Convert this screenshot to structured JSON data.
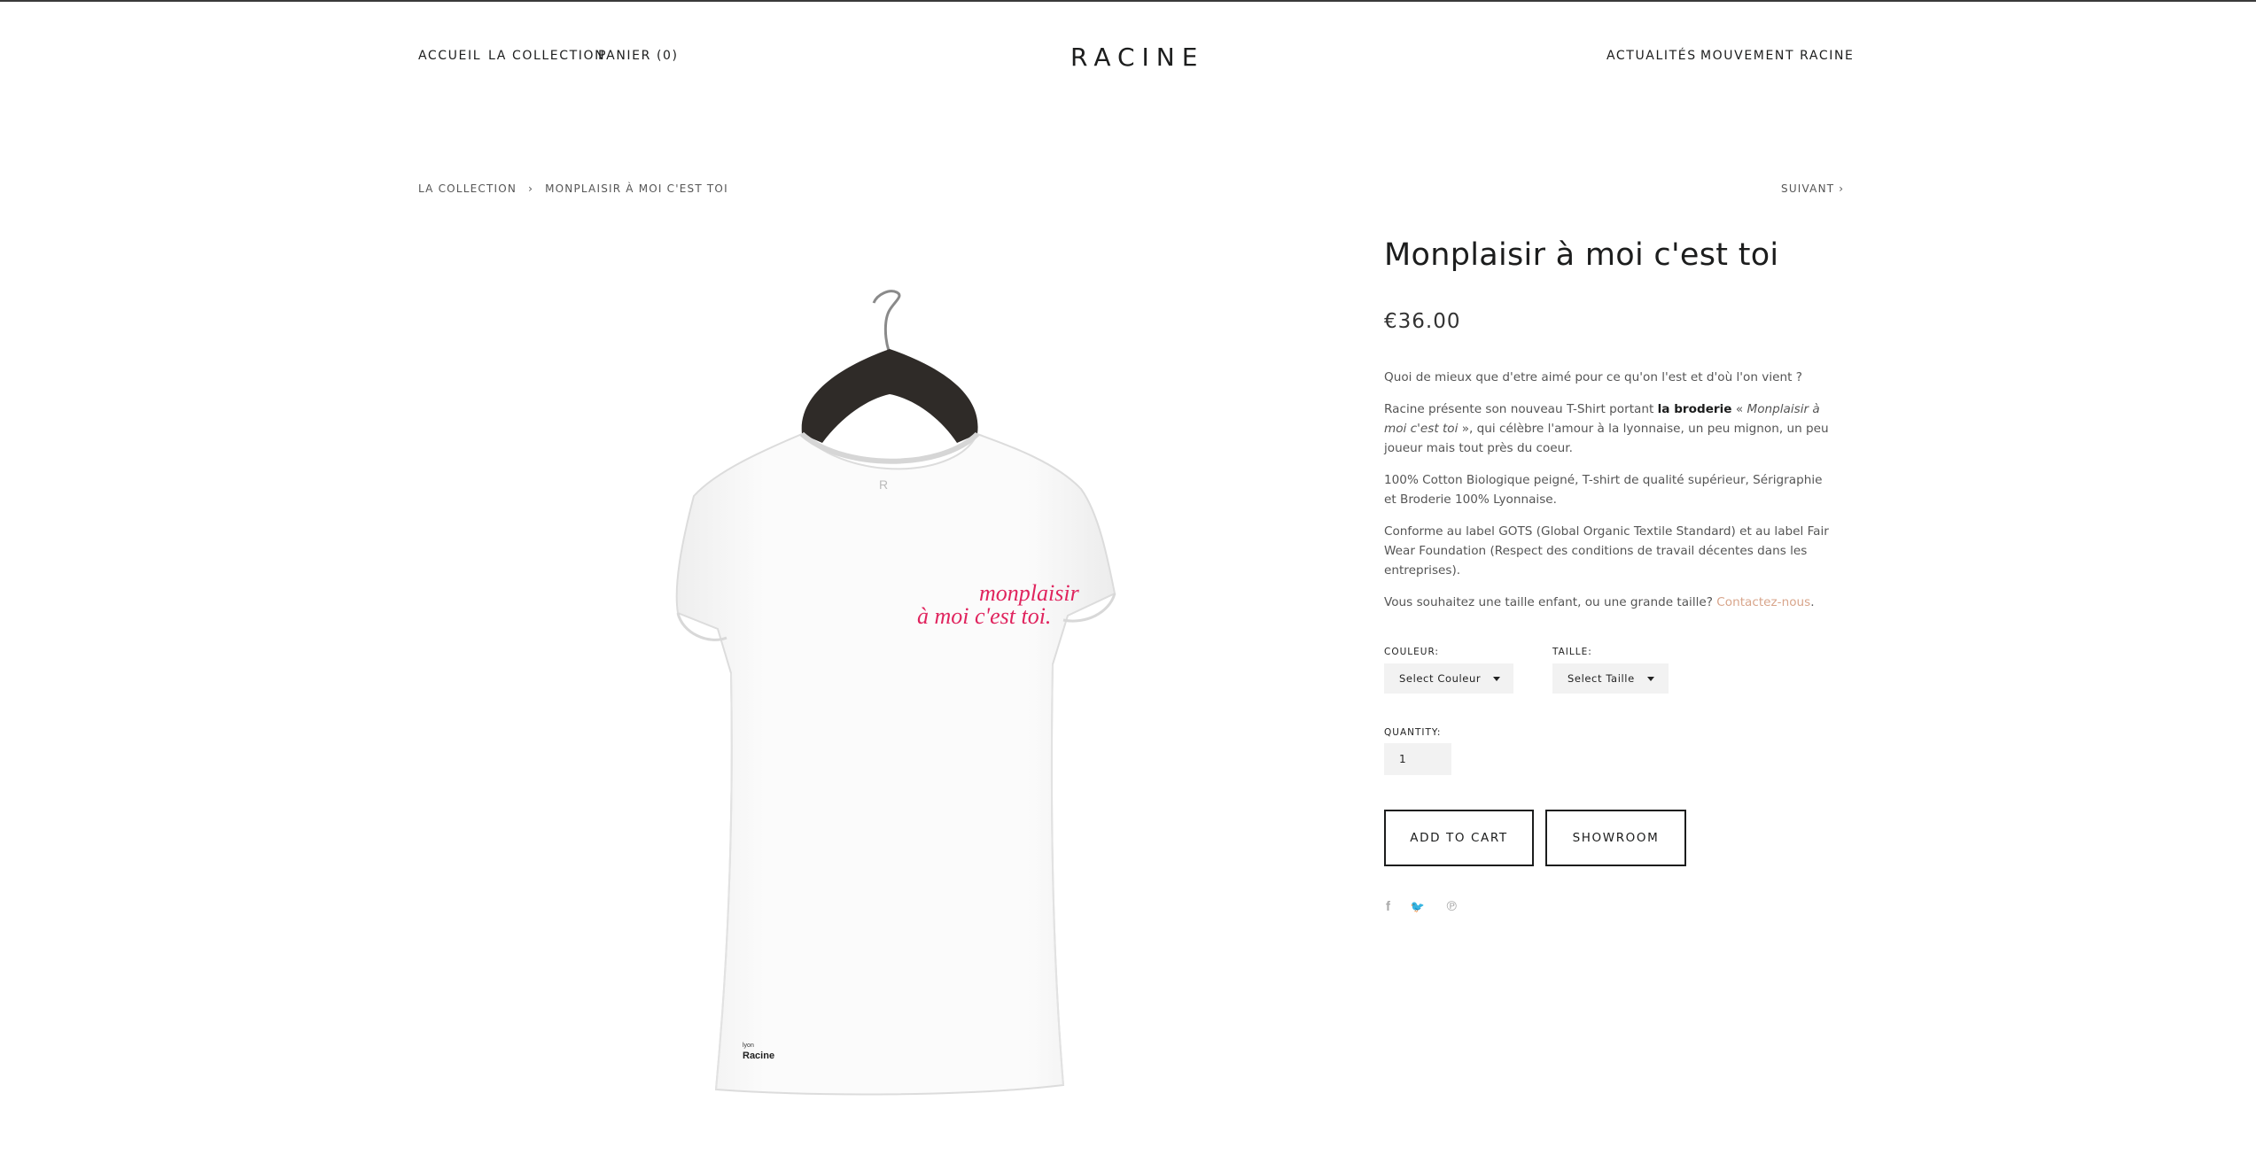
{
  "header": {
    "left_nav": [
      "ACCUEIL",
      "LA COLLECTION",
      "PANIER (0)"
    ],
    "logo": "RACINE",
    "right_nav": [
      "ACTUALITÉS",
      "MOUVEMENT RACINE"
    ]
  },
  "breadcrumb": {
    "parent": "LA COLLECTION",
    "separator": "›",
    "current": "MONPLAISIR À MOI C'EST TOI",
    "next": "SUIVANT ›"
  },
  "product": {
    "title": "Monplaisir à moi c'est toi",
    "price": "€36.00",
    "image": {
      "embroidery_line1": "monplaisir",
      "embroidery_line2": "à moi c'est toi.",
      "tag_small": "lyon",
      "tag_brand": "Racine",
      "neck_label": "R"
    },
    "description": {
      "p1": "Quoi de mieux que d'etre aimé pour ce qu'on l'est et d'où l'on vient ?",
      "p2_a": "Racine présente son nouveau T-Shirt portant ",
      "p2_bold": "la broderie",
      "p2_b": " « ",
      "p2_italic": "Monplaisir à moi c'est toi",
      "p2_c": " », qui célèbre l'amour à la lyonnaise, un peu mignon, un peu joueur mais tout près du coeur.",
      "p3": "100% Cotton Biologique peigné, T-shirt de qualité supérieur, Sérigraphie et Broderie 100% Lyonnaise.",
      "p4": "Conforme au label GOTS (Global Organic Textile Standard) et au label Fair Wear Foundation (Respect des conditions de travail décentes dans les entreprises).",
      "p5": "Vous souhaitez une taille enfant, ou une grande taille? ",
      "p5_link": "Contactez-nous",
      "p5_end": "."
    },
    "options": {
      "color_label": "COULEUR:",
      "color_value": "Select Couleur",
      "size_label": "TAILLE:",
      "size_value": "Select Taille",
      "quantity_label": "QUANTITY:",
      "quantity_value": "1"
    },
    "buttons": {
      "add_to_cart": "ADD TO CART",
      "showroom": "SHOWROOM"
    },
    "social": {
      "facebook": "f",
      "twitter": "🐦",
      "pinterest": "℗"
    }
  },
  "colors": {
    "text": "#1c1d1d",
    "link_accent": "#d8a58b",
    "embroidery": "#e0245e",
    "select_bg": "#f2f2f2"
  }
}
